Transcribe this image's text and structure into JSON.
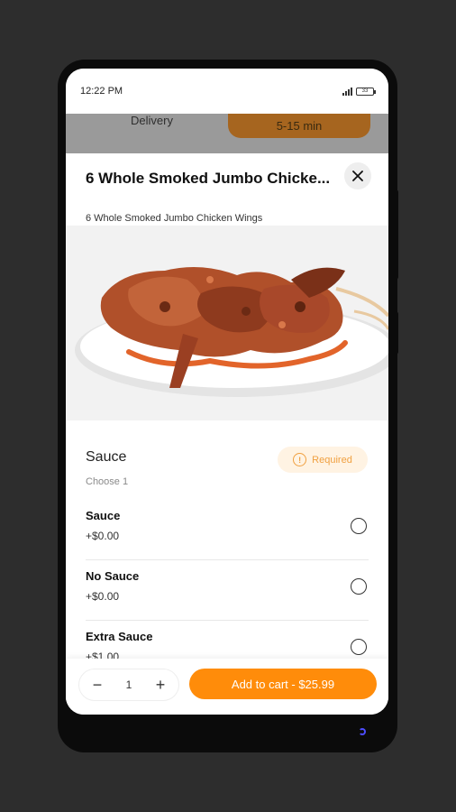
{
  "status_bar": {
    "time": "12:22 PM",
    "battery": "33"
  },
  "background_view": {
    "delivery_label": "Delivery",
    "time_pill": "5-15 min"
  },
  "item": {
    "title": "6 Whole Smoked Jumbo Chicke...",
    "description": "6 Whole Smoked Jumbo Chicken Wings",
    "image": "chicken-wings-photo"
  },
  "modifier_group": {
    "title": "Sauce",
    "subtitle": "Choose 1",
    "required_label": "Required",
    "options": [
      {
        "name": "Sauce",
        "price": "+$0.00",
        "selected": false
      },
      {
        "name": "No Sauce",
        "price": "+$0.00",
        "selected": false
      },
      {
        "name": "Extra Sauce",
        "price": "+$1.00",
        "selected": false
      }
    ]
  },
  "cart_bar": {
    "minus_icon": "minus-icon",
    "quantity": "1",
    "plus_icon": "plus-icon",
    "add_label": "Add to cart - $25.99"
  },
  "colors": {
    "accent": "#ff8c0a",
    "required_bg": "#fff3e3",
    "required_text": "#f0a040"
  }
}
